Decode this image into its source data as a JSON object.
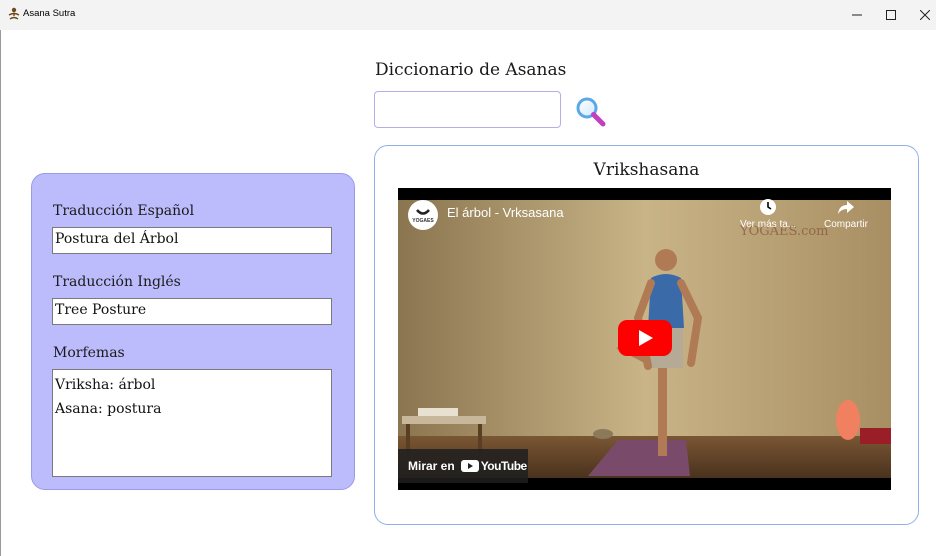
{
  "window": {
    "title": "Asana Sutra",
    "controls": {
      "minimize": "minimize-icon",
      "maximize": "maximize-icon",
      "close": "close-icon"
    }
  },
  "header": {
    "title": "Diccionario de Asanas",
    "search": {
      "value": "",
      "placeholder": "",
      "icon": "magnifier-icon"
    }
  },
  "details": {
    "spanish": {
      "label": "Traducción Español",
      "value": "Postura del Árbol"
    },
    "english": {
      "label": "Traducción Inglés",
      "value": "Tree Posture"
    },
    "morphemes": {
      "label": "Morfemas",
      "lines": [
        "Vriksha: árbol",
        "Asana: postura"
      ]
    }
  },
  "video": {
    "asana_name": "Vrikshasana",
    "title": "El árbol - Vrksasana",
    "channel": "YOGAES",
    "watermark": "YOGAES.com",
    "watch_later": "Ver más ta...",
    "share": "Compartir",
    "watch_on_prefix": "Mirar en",
    "watch_on_brand": "YouTube"
  },
  "colors": {
    "panel_bg": "#bcbcfc",
    "accent_border": "#8fb0e6",
    "search_border": "#b6aee8",
    "youtube_red": "#ff0000"
  }
}
